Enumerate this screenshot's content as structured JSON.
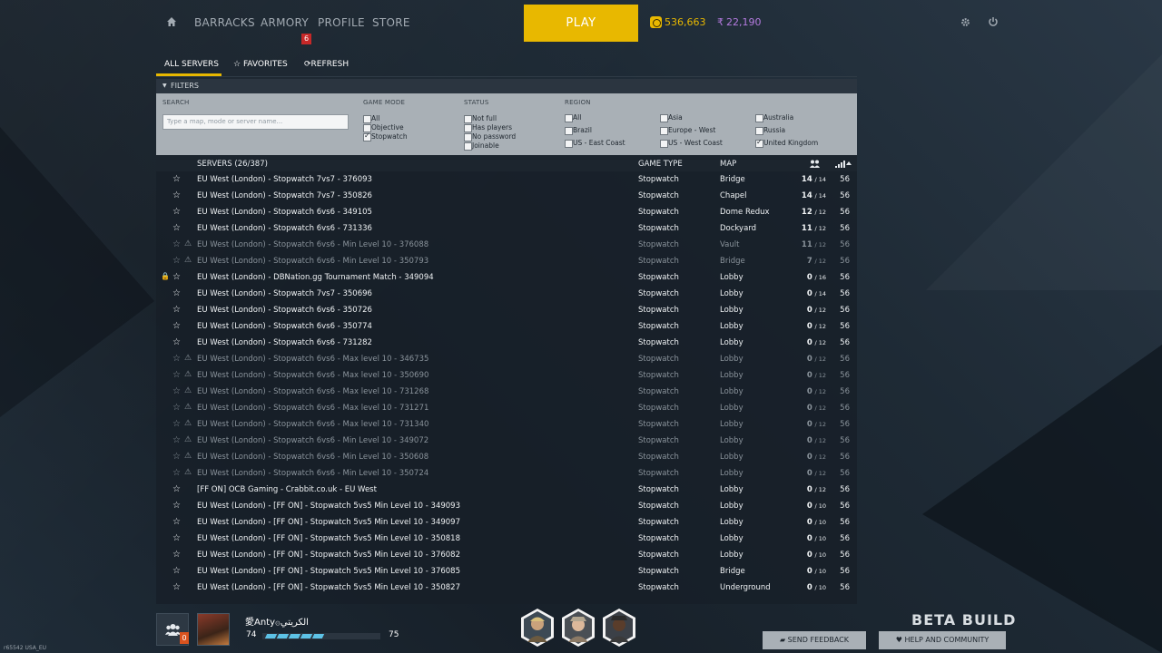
{
  "nav": {
    "items": [
      "BARRACKS",
      "ARMORY",
      "PROFILE",
      "STORE"
    ],
    "armory_badge": "6",
    "play_label": "PLAY",
    "coins": "536,663",
    "credits": "22,190",
    "credits_symbol": "₹"
  },
  "tabs": {
    "all_servers": "ALL SERVERS",
    "favorites": "FAVORITES",
    "refresh": "REFRESH"
  },
  "filters": {
    "header": "FILTERS",
    "search_label": "SEARCH",
    "search_placeholder": "Type a map, mode or server name...",
    "game_mode_label": "GAME MODE",
    "game_mode": [
      {
        "label": "All",
        "checked": false
      },
      {
        "label": "Objective",
        "checked": false
      },
      {
        "label": "Stopwatch",
        "checked": true
      }
    ],
    "status_label": "STATUS",
    "status": [
      {
        "label": "Not full",
        "checked": false
      },
      {
        "label": "Has players",
        "checked": false
      },
      {
        "label": "No password",
        "checked": false
      },
      {
        "label": "Joinable",
        "checked": false
      }
    ],
    "region_label": "REGION",
    "region": [
      {
        "label": "All",
        "checked": false
      },
      {
        "label": "Brazil",
        "checked": false
      },
      {
        "label": "US - East Coast",
        "checked": false
      },
      {
        "label": "Asia",
        "checked": false
      },
      {
        "label": "Europe - West",
        "checked": false
      },
      {
        "label": "US - West Coast",
        "checked": false
      },
      {
        "label": "Australia",
        "checked": false
      },
      {
        "label": "Russia",
        "checked": false
      },
      {
        "label": "United Kingdom",
        "checked": true
      }
    ]
  },
  "table": {
    "servers_header": "SERVERS (26/387)",
    "game_type_header": "GAME TYPE",
    "map_header": "MAP",
    "rows": [
      {
        "name": "EU West (London) - Stopwatch 7vs7 - 376093",
        "type": "Stopwatch",
        "map": "Bridge",
        "players": "14",
        "max": "/ 14",
        "ping": "56",
        "dim": false,
        "warn": false,
        "lock": false
      },
      {
        "name": "EU West (London) - Stopwatch 7vs7 - 350826",
        "type": "Stopwatch",
        "map": "Chapel",
        "players": "14",
        "max": "/ 14",
        "ping": "56",
        "dim": false,
        "warn": false,
        "lock": false
      },
      {
        "name": "EU West (London) - Stopwatch 6vs6 - 349105",
        "type": "Stopwatch",
        "map": "Dome Redux",
        "players": "12",
        "max": "/ 12",
        "ping": "56",
        "dim": false,
        "warn": false,
        "lock": false
      },
      {
        "name": "EU West (London) - Stopwatch 6vs6 - 731336",
        "type": "Stopwatch",
        "map": "Dockyard",
        "players": "11",
        "max": "/ 12",
        "ping": "56",
        "dim": false,
        "warn": false,
        "lock": false
      },
      {
        "name": "EU West (London) - Stopwatch 6vs6 - Min Level 10 - 376088",
        "type": "Stopwatch",
        "map": "Vault",
        "players": "11",
        "max": "/ 12",
        "ping": "56",
        "dim": true,
        "warn": true,
        "lock": false
      },
      {
        "name": "EU West (London) - Stopwatch 6vs6 - Min Level 10 - 350793",
        "type": "Stopwatch",
        "map": "Bridge",
        "players": "7",
        "max": "/ 12",
        "ping": "56",
        "dim": true,
        "warn": true,
        "lock": false
      },
      {
        "name": "EU West (London) - DBNation.gg Tournament Match - 349094",
        "type": "Stopwatch",
        "map": "Lobby",
        "players": "0",
        "max": "/ 16",
        "ping": "56",
        "dim": false,
        "warn": false,
        "lock": true
      },
      {
        "name": "EU West (London) - Stopwatch 7vs7 - 350696",
        "type": "Stopwatch",
        "map": "Lobby",
        "players": "0",
        "max": "/ 14",
        "ping": "56",
        "dim": false,
        "warn": false,
        "lock": false
      },
      {
        "name": "EU West (London) - Stopwatch 6vs6 - 350726",
        "type": "Stopwatch",
        "map": "Lobby",
        "players": "0",
        "max": "/ 12",
        "ping": "56",
        "dim": false,
        "warn": false,
        "lock": false
      },
      {
        "name": "EU West (London) - Stopwatch 6vs6 - 350774",
        "type": "Stopwatch",
        "map": "Lobby",
        "players": "0",
        "max": "/ 12",
        "ping": "56",
        "dim": false,
        "warn": false,
        "lock": false
      },
      {
        "name": "EU West (London) - Stopwatch 6vs6 - 731282",
        "type": "Stopwatch",
        "map": "Lobby",
        "players": "0",
        "max": "/ 12",
        "ping": "56",
        "dim": false,
        "warn": false,
        "lock": false
      },
      {
        "name": "EU West (London) - Stopwatch 6vs6 - Max level 10 - 346735",
        "type": "Stopwatch",
        "map": "Lobby",
        "players": "0",
        "max": "/ 12",
        "ping": "56",
        "dim": true,
        "warn": true,
        "lock": false
      },
      {
        "name": "EU West (London) - Stopwatch 6vs6 - Max level 10 - 350690",
        "type": "Stopwatch",
        "map": "Lobby",
        "players": "0",
        "max": "/ 12",
        "ping": "56",
        "dim": true,
        "warn": true,
        "lock": false
      },
      {
        "name": "EU West (London) - Stopwatch 6vs6 - Max level 10 - 731268",
        "type": "Stopwatch",
        "map": "Lobby",
        "players": "0",
        "max": "/ 12",
        "ping": "56",
        "dim": true,
        "warn": true,
        "lock": false
      },
      {
        "name": "EU West (London) - Stopwatch 6vs6 - Max level 10 - 731271",
        "type": "Stopwatch",
        "map": "Lobby",
        "players": "0",
        "max": "/ 12",
        "ping": "56",
        "dim": true,
        "warn": true,
        "lock": false
      },
      {
        "name": "EU West (London) - Stopwatch 6vs6 - Max level 10 - 731340",
        "type": "Stopwatch",
        "map": "Lobby",
        "players": "0",
        "max": "/ 12",
        "ping": "56",
        "dim": true,
        "warn": true,
        "lock": false
      },
      {
        "name": "EU West (London) - Stopwatch 6vs6 - Min Level 10 - 349072",
        "type": "Stopwatch",
        "map": "Lobby",
        "players": "0",
        "max": "/ 12",
        "ping": "56",
        "dim": true,
        "warn": true,
        "lock": false
      },
      {
        "name": "EU West (London) - Stopwatch 6vs6 - Min Level 10 - 350608",
        "type": "Stopwatch",
        "map": "Lobby",
        "players": "0",
        "max": "/ 12",
        "ping": "56",
        "dim": true,
        "warn": true,
        "lock": false
      },
      {
        "name": "EU West (London) - Stopwatch 6vs6 - Min Level 10 - 350724",
        "type": "Stopwatch",
        "map": "Lobby",
        "players": "0",
        "max": "/ 12",
        "ping": "56",
        "dim": true,
        "warn": true,
        "lock": false
      },
      {
        "name": "[FF ON] OCB Gaming - Crabbit.co.uk - EU West",
        "type": "Stopwatch",
        "map": "Lobby",
        "players": "0",
        "max": "/ 12",
        "ping": "56",
        "dim": false,
        "warn": false,
        "lock": false
      },
      {
        "name": "EU West (London) - [FF ON] - Stopwatch 5vs5 Min Level 10 - 349093",
        "type": "Stopwatch",
        "map": "Lobby",
        "players": "0",
        "max": "/ 10",
        "ping": "56",
        "dim": false,
        "warn": false,
        "lock": false
      },
      {
        "name": "EU West (London) - [FF ON] - Stopwatch 5vs5 Min Level 10 - 349097",
        "type": "Stopwatch",
        "map": "Lobby",
        "players": "0",
        "max": "/ 10",
        "ping": "56",
        "dim": false,
        "warn": false,
        "lock": false
      },
      {
        "name": "EU West (London) - [FF ON] - Stopwatch 5vs5 Min Level 10 - 350818",
        "type": "Stopwatch",
        "map": "Lobby",
        "players": "0",
        "max": "/ 10",
        "ping": "56",
        "dim": false,
        "warn": false,
        "lock": false
      },
      {
        "name": "EU West (London) - [FF ON] - Stopwatch 5vs5 Min Level 10 - 376082",
        "type": "Stopwatch",
        "map": "Lobby",
        "players": "0",
        "max": "/ 10",
        "ping": "56",
        "dim": false,
        "warn": false,
        "lock": false
      },
      {
        "name": "EU West (London) - [FF ON] - Stopwatch 5vs5 Min Level 10 - 376085",
        "type": "Stopwatch",
        "map": "Bridge",
        "players": "0",
        "max": "/ 10",
        "ping": "56",
        "dim": false,
        "warn": false,
        "lock": false
      },
      {
        "name": "EU West (London) - [FF ON] - Stopwatch 5vs5 Min Level 10 - 350827",
        "type": "Stopwatch",
        "map": "Underground",
        "players": "0",
        "max": "/ 10",
        "ping": "56",
        "dim": false,
        "warn": false,
        "lock": false
      }
    ]
  },
  "bottom": {
    "friends_badge": "0",
    "player_name": "愛Anty۞الكريتي",
    "level": "74",
    "next_level": "75",
    "xp_progress": 0.5,
    "beta_label": "BETA BUILD",
    "send_feedback": "SEND FEEDBACK",
    "help_community": "HELP AND COMMUNITY",
    "build_version": "r65542 USA_EU"
  },
  "colors": {
    "accent": "#e8b800",
    "credits": "#b57be0",
    "xp": "#5dc2e6",
    "badge": "#c62828"
  }
}
